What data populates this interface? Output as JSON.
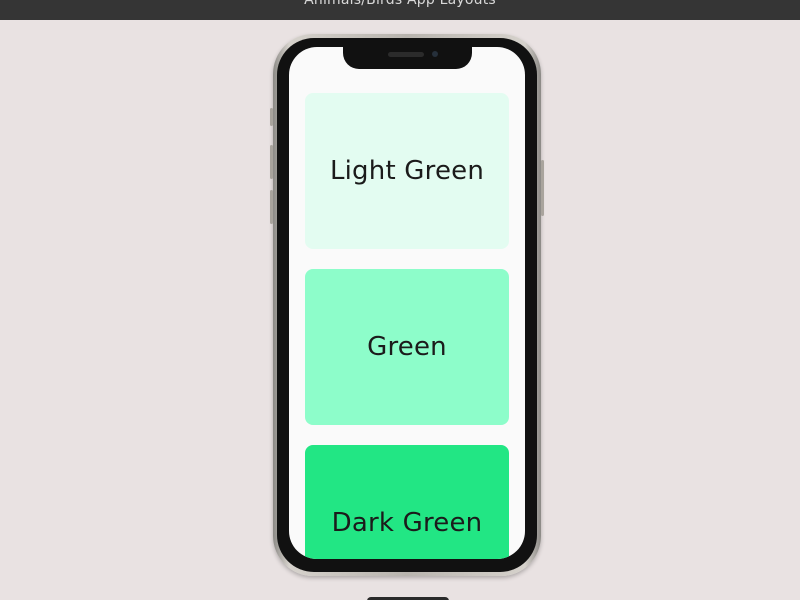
{
  "window": {
    "title": "Animals/Birds App Layouts"
  },
  "cards": [
    {
      "label": "Light Green",
      "color": "#e3fcf1"
    },
    {
      "label": "Green",
      "color": "#8dfdca"
    },
    {
      "label": "Dark Green",
      "color": "#22e684"
    }
  ],
  "colors": {
    "background": "#e9e2e2",
    "title_bar": "#353535",
    "screen": "#fafafa"
  }
}
